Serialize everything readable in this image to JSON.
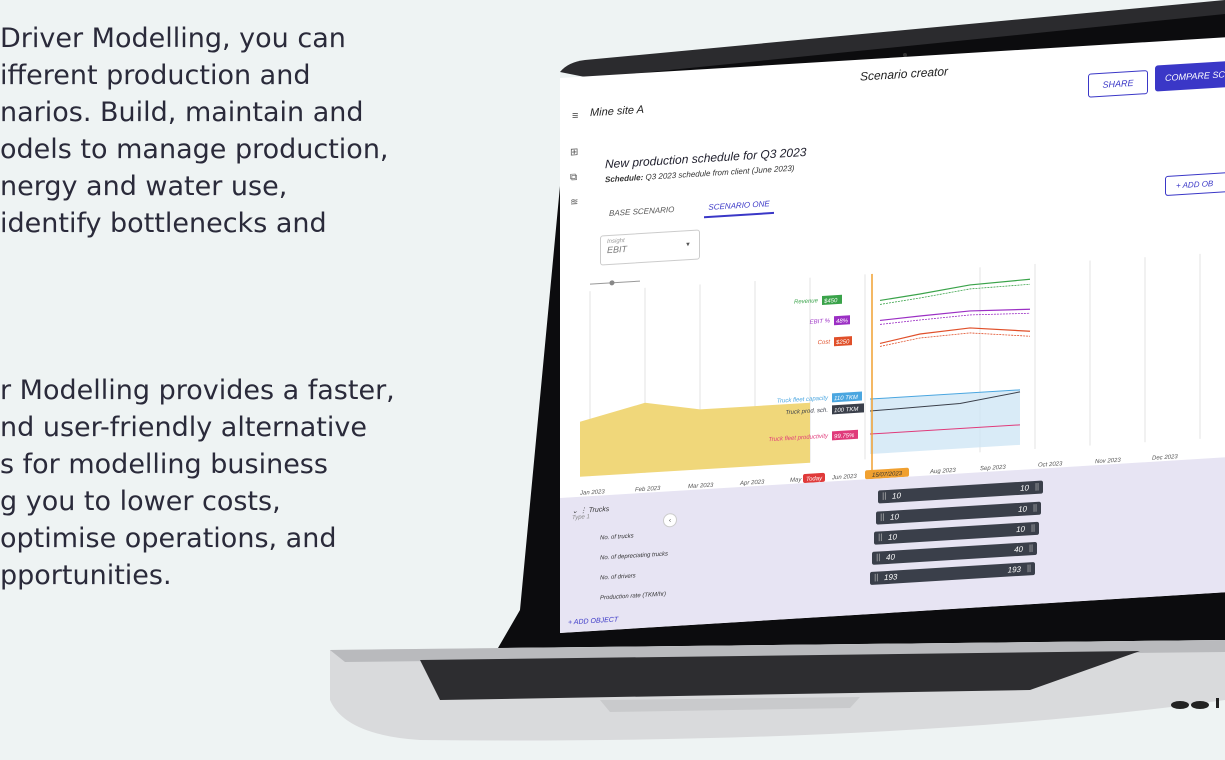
{
  "marketing": {
    "para1": [
      "Driver Modelling, you can",
      "ifferent production and",
      "narios. Build, maintain and",
      "odels to manage production,",
      "nergy and water use,",
      "identify bottlenecks and"
    ],
    "para2": [
      "r Modelling provides a faster,",
      "nd user-friendly alternative",
      "s for modelling business",
      "g you to lower costs,",
      "optimise operations, and",
      "pportunities."
    ]
  },
  "app": {
    "title": "Scenario creator",
    "site": "Mine site A",
    "share_label": "SHARE",
    "compare_label": "COMPARE SCEN",
    "page_title": "New production schedule for Q3 2023",
    "schedule_label": "Schedule:",
    "schedule_value": "Q3 2023 schedule from client (June 2023)",
    "tabs": [
      {
        "label": "BASE SCENARIO"
      },
      {
        "label": "SCENARIO ONE"
      }
    ],
    "add_object_label": "+ ADD OB",
    "insight": {
      "label": "Insight",
      "value": "EBIT"
    },
    "add_object_bottom": "+ ADD OBJECT"
  },
  "chart_data": {
    "type": "line",
    "x_ticks": [
      "Jan 2023",
      "Feb 2023",
      "Mar 2023",
      "Apr 2023",
      "May",
      "Jun 2023",
      "15/07/2023",
      "Aug 2023",
      "Sep 2023",
      "Oct 2023",
      "Nov 2023",
      "Dec 2023"
    ],
    "today_label": "Today",
    "metric_labels": [
      {
        "name": "Revenue",
        "value": "$450",
        "color": "#3aa34a"
      },
      {
        "name": "EBIT %",
        "value": "48%",
        "color": "#9b2fc4"
      },
      {
        "name": "Cost",
        "value": "$250",
        "color": "#e0502a"
      },
      {
        "name": "Truck fleet capacity",
        "value": "110 TKM",
        "color": "#4aa6e0"
      },
      {
        "name": "Truck prod. sch.",
        "value": "100 TKM",
        "color": "#3a3f4a"
      },
      {
        "name": "Truck fleet productivity",
        "value": "99.75%",
        "color": "#e03a7a"
      }
    ]
  },
  "panel": {
    "group": "Trucks",
    "group_type": "Type 1",
    "rows": [
      {
        "label": "No. of trucks",
        "left": "10",
        "right": "10"
      },
      {
        "label": "No. of depreciating trucks",
        "left": "10",
        "right": "10"
      },
      {
        "label": "No. of drivers",
        "left": "40",
        "right": "40"
      },
      {
        "label": "Production rate (TKM/hr)",
        "left": "193",
        "right": "193"
      }
    ],
    "first_bar": {
      "left": "10",
      "right": "10"
    }
  }
}
